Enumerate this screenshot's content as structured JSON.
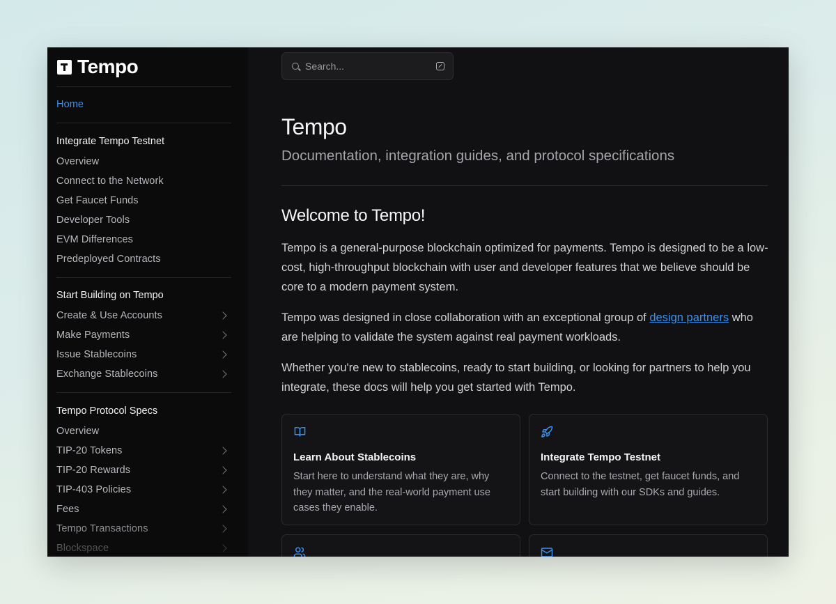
{
  "sidebar": {
    "logo_text": "Tempo",
    "home": "Home",
    "sections": [
      {
        "title": "Integrate Tempo Testnet",
        "items": [
          {
            "label": "Overview",
            "chevron": false
          },
          {
            "label": "Connect to the Network",
            "chevron": false
          },
          {
            "label": "Get Faucet Funds",
            "chevron": false
          },
          {
            "label": "Developer Tools",
            "chevron": false
          },
          {
            "label": "EVM Differences",
            "chevron": false
          },
          {
            "label": "Predeployed Contracts",
            "chevron": false
          }
        ]
      },
      {
        "title": "Start Building on Tempo",
        "items": [
          {
            "label": "Create & Use Accounts",
            "chevron": true
          },
          {
            "label": "Make Payments",
            "chevron": true
          },
          {
            "label": "Issue Stablecoins",
            "chevron": true
          },
          {
            "label": "Exchange Stablecoins",
            "chevron": true
          }
        ]
      },
      {
        "title": "Tempo Protocol Specs",
        "items": [
          {
            "label": "Overview",
            "chevron": false
          },
          {
            "label": "TIP-20 Tokens",
            "chevron": true
          },
          {
            "label": "TIP-20 Rewards",
            "chevron": true
          },
          {
            "label": "TIP-403 Policies",
            "chevron": true
          },
          {
            "label": "Fees",
            "chevron": true
          },
          {
            "label": "Tempo Transactions",
            "chevron": true
          },
          {
            "label": "Blockspace",
            "chevron": true
          }
        ]
      }
    ]
  },
  "search": {
    "placeholder": "Search..."
  },
  "main": {
    "title": "Tempo",
    "subtitle": "Documentation, integration guides, and protocol specifications",
    "welcome": "Welcome to Tempo!",
    "para1": "Tempo is a general-purpose blockchain optimized for payments. Tempo is designed to be a low-cost, high-throughput blockchain with user and developer features that we believe should be core to a modern payment system.",
    "para2_before": "Tempo was designed in close collaboration with an exceptional group of ",
    "para2_link": "design partners",
    "para2_after": " who are helping to validate the system against real payment workloads.",
    "para3": "Whether you're new to stablecoins, ready to start building, or looking for partners to help you integrate, these docs will help you get started with Tempo.",
    "cards": [
      {
        "icon": "book-icon",
        "title": "Learn About Stablecoins",
        "desc": "Start here to understand what they are, why they matter, and the real-world payment use cases they enable."
      },
      {
        "icon": "rocket-icon",
        "title": "Integrate Tempo Testnet",
        "desc": "Connect to the testnet, get faucet funds, and start building with our SDKs and guides."
      },
      {
        "icon": "users-icon",
        "title": "",
        "desc": ""
      },
      {
        "icon": "mail-icon",
        "title": "",
        "desc": ""
      }
    ]
  },
  "colors": {
    "accent": "#3b91f0",
    "background": "#111113",
    "sidebar": "#0b0b0c"
  }
}
